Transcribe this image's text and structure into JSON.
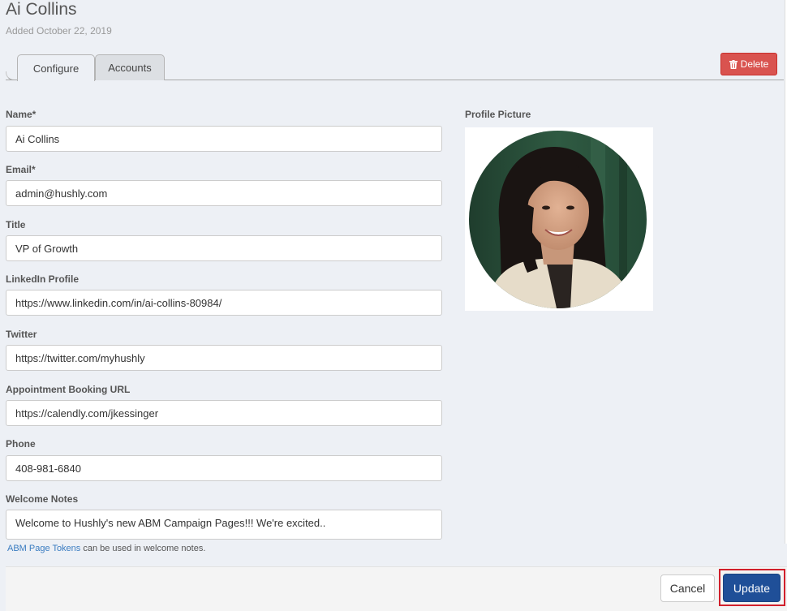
{
  "header": {
    "title": "Ai Collins",
    "subtitle": "Added October 22, 2019"
  },
  "tabs": [
    {
      "label": "Configure",
      "active": true
    },
    {
      "label": "Accounts",
      "active": false
    }
  ],
  "actions": {
    "delete_label": "Delete",
    "cancel_label": "Cancel",
    "update_label": "Update"
  },
  "form": {
    "name": {
      "label": "Name*",
      "value": "Ai Collins"
    },
    "email": {
      "label": "Email*",
      "value": "admin@hushly.com"
    },
    "title": {
      "label": "Title",
      "value": "VP of Growth"
    },
    "linkedin": {
      "label": "LinkedIn Profile",
      "value": "https://www.linkedin.com/in/ai-collins-80984/"
    },
    "twitter": {
      "label": "Twitter",
      "value": "https://twitter.com/myhushly"
    },
    "booking": {
      "label": "Appointment Booking URL",
      "value": "https://calendly.com/jkessinger"
    },
    "phone": {
      "label": "Phone",
      "value": "408-981-6840"
    },
    "welcome": {
      "label": "Welcome Notes",
      "value": "Welcome to Hushly's new ABM Campaign Pages!!!   We're excited.."
    },
    "help_link": "ABM Page Tokens",
    "help_text": " can be used in welcome notes."
  },
  "profile": {
    "label": "Profile Picture"
  },
  "colors": {
    "delete": "#d9534f",
    "update": "#1f4f98",
    "highlight": "#d11f2b",
    "link": "#3a7cc1"
  },
  "icons": {
    "delete": "trash-icon"
  }
}
